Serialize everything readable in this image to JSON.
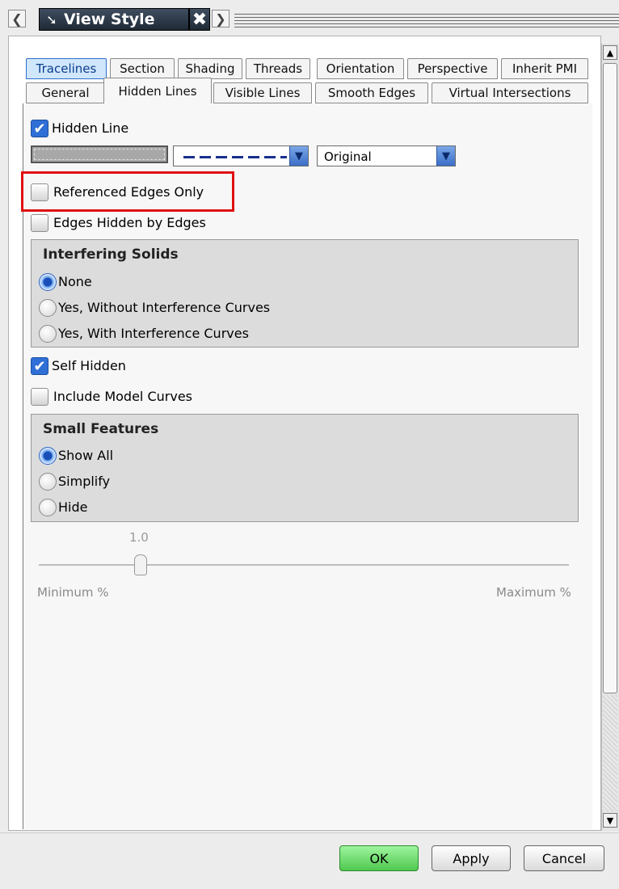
{
  "window": {
    "title": "View Style",
    "prev_icon": "left-arrow",
    "next_icon": "right-arrow",
    "close_icon": "close-x"
  },
  "tabs": {
    "row1": [
      "Tracelines",
      "Section",
      "Shading",
      "Threads",
      "Orientation",
      "Perspective",
      "Inherit PMI"
    ],
    "row2": [
      "General",
      "Hidden Lines",
      "Visible Lines",
      "Smooth Edges",
      "Virtual Intersections"
    ],
    "active": "Hidden Lines"
  },
  "hidden_line": {
    "checkbox_label": "Hidden Line",
    "checked": true,
    "line_style": "dashed",
    "line_width": "Original"
  },
  "referenced_edges_only": {
    "label": "Referenced Edges Only",
    "checked": false
  },
  "edges_hidden_by_edges": {
    "label": "Edges Hidden by Edges",
    "checked": false
  },
  "interfering_solids": {
    "title": "Interfering Solids",
    "options": [
      "None",
      "Yes, Without Interference Curves",
      "Yes, With Interference Curves"
    ],
    "selected": "None"
  },
  "self_hidden": {
    "label": "Self Hidden",
    "checked": true
  },
  "include_model_curves": {
    "label": "Include Model Curves",
    "checked": false
  },
  "small_features": {
    "title": "Small Features",
    "options": [
      "Show All",
      "Simplify",
      "Hide"
    ],
    "selected": "Show All"
  },
  "slider": {
    "value": "1.0",
    "min_label": "Minimum %",
    "max_label": "Maximum %",
    "enabled": false
  },
  "buttons": {
    "ok": "OK",
    "apply": "Apply",
    "cancel": "Cancel"
  },
  "colors": {
    "highlight": "#e01010",
    "tracelines_tab": "#cfe6fb",
    "ok_button": "#4fc84f",
    "check_blue": "#2f6fd6"
  }
}
